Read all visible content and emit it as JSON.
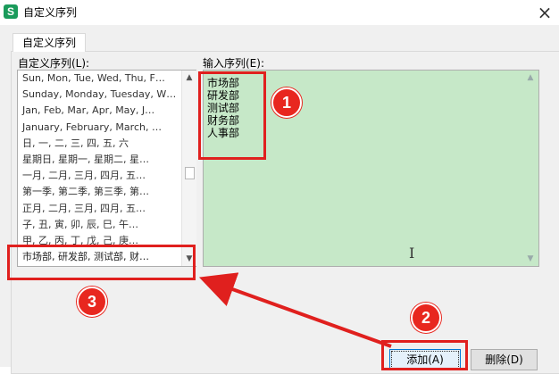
{
  "window": {
    "title": "自定义序列",
    "close_glyph": "×",
    "app_icon_letter": "S"
  },
  "tab": {
    "label": "自定义序列"
  },
  "custom_list": {
    "label": "自定义序列(L):",
    "items": [
      "Sun, Mon, Tue, Wed, Thu, F…",
      "Sunday, Monday, Tuesday, W…",
      "Jan, Feb, Mar, Apr, May, J…",
      "January, February, March, …",
      "日, 一, 二, 三, 四, 五, 六",
      "星期日, 星期一, 星期二, 星…",
      "一月, 二月, 三月, 四月, 五…",
      "第一季, 第二季, 第三季, 第…",
      "正月, 二月, 三月, 四月, 五…",
      "子, 丑, 寅, 卯, 辰, 巳, 午…",
      "甲, 乙, 丙, 丁, 戊, 己, 庚…",
      "市场部, 研发部, 测试部, 财…"
    ]
  },
  "input_sequence": {
    "label": "输入序列(E):",
    "value": "市场部\n研发部\n测试部\n财务部\n人事部"
  },
  "buttons": {
    "add": "添加(A)",
    "delete": "删除(D)"
  },
  "annotations": {
    "badge1": "1",
    "badge2": "2",
    "badge3": "3",
    "color": "#e0201e"
  },
  "icons": {
    "scroll_up": "▲",
    "scroll_down": "▼",
    "text_cursor": "I"
  }
}
